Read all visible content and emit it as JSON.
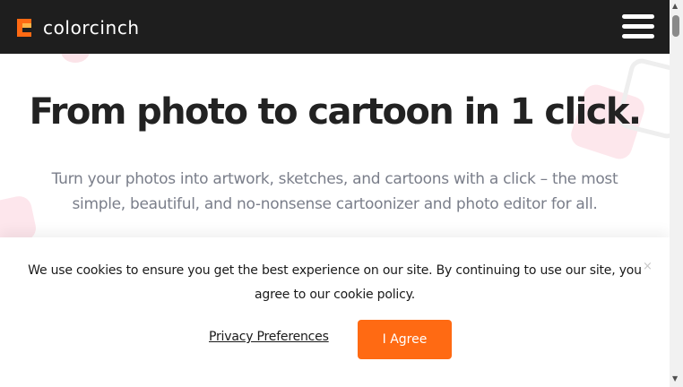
{
  "brand": {
    "name": "colorcinch",
    "accent": "#ff6a13",
    "header_bg": "#1e1e1e"
  },
  "header": {
    "menu_icon": "hamburger-menu-icon"
  },
  "hero": {
    "title": "From photo to cartoon in 1 click.",
    "subtitle": "Turn your photos into artwork, sketches, and cartoons with a click – the most simple, beautiful, and no-nonsense cartoonizer and photo editor for all."
  },
  "cookie_banner": {
    "message": "We use cookies to ensure you get the best experience on our site. By continuing to use our site, you agree to our cookie policy.",
    "close_symbol": "×",
    "privacy_link": "Privacy Preferences",
    "agree_button": "I Agree"
  },
  "scrollbar": {
    "up_arrow": "▲",
    "down_arrow": "▼"
  }
}
